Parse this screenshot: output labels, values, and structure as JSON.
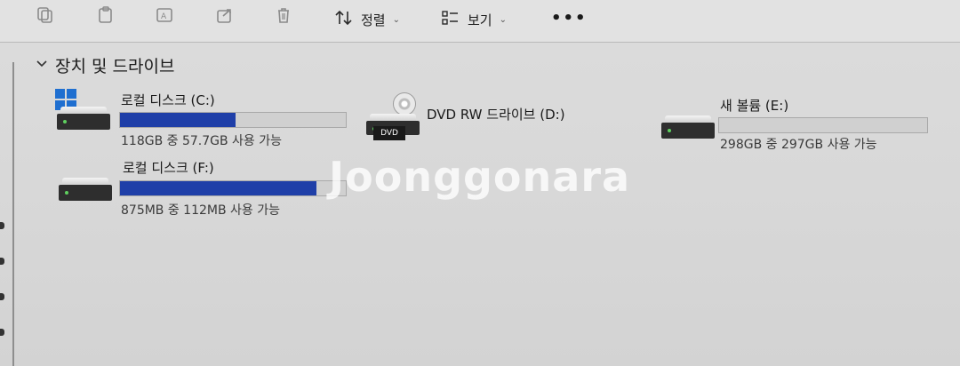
{
  "toolbar": {
    "sort_label": "정렬",
    "view_label": "보기",
    "more_label": "•••",
    "icons": [
      "copy-icon",
      "paste-icon",
      "rename-icon",
      "share-icon",
      "delete-icon",
      "sort-icon",
      "view-icon"
    ]
  },
  "group": {
    "title": "장치 및 드라이브"
  },
  "drives": [
    {
      "name": "로컬 디스크 (C:)",
      "free": "118GB 중 57.7GB 사용 가능",
      "used_fraction": 0.51
    },
    {
      "name": "DVD RW 드라이브 (D:)",
      "icon_label": "DVD"
    },
    {
      "name": "새 볼륨 (E:)",
      "free": "298GB 중 297GB 사용 가능",
      "used_fraction": 0.0
    },
    {
      "name": "로컬 디스크 (F:)",
      "free": "875MB 중 112MB 사용 가능",
      "used_fraction": 0.87
    }
  ],
  "watermark": "Joonggonara",
  "colors": {
    "bar_fill": "#1f3fa8",
    "bar_empty": "#d0d0d0",
    "background": "#d9d9d9"
  }
}
